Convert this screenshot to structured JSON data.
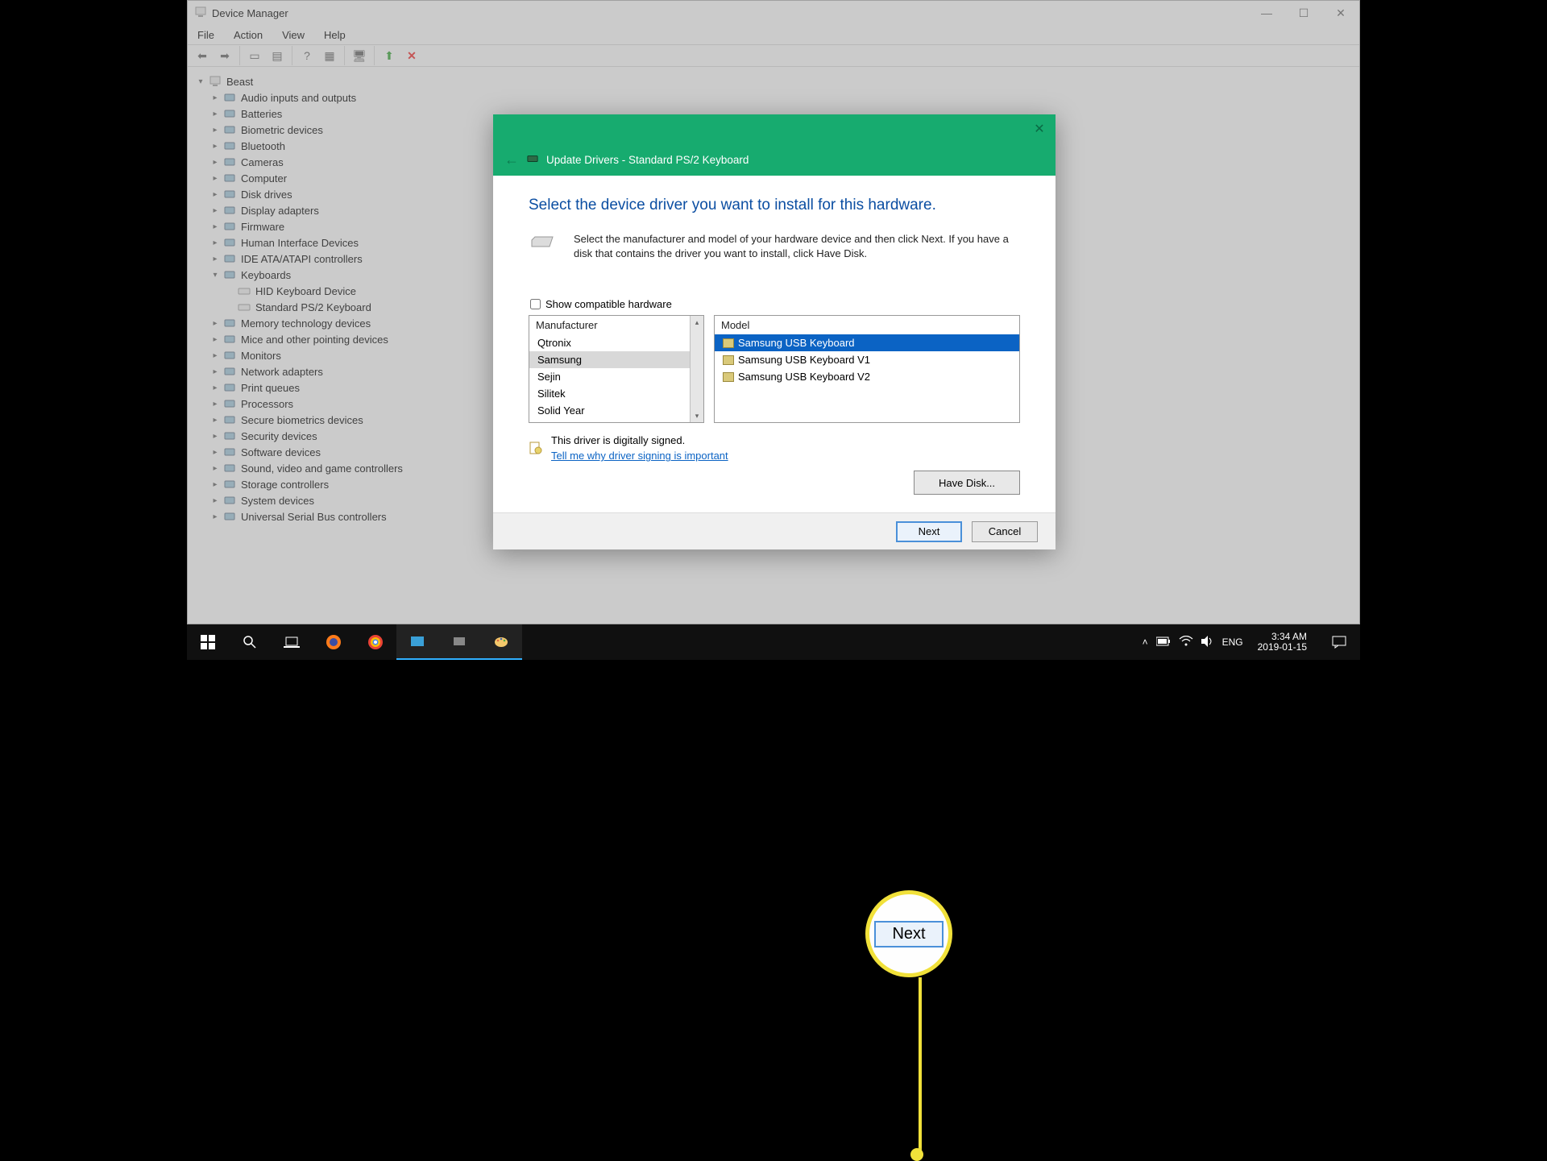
{
  "window": {
    "title": "Device Manager",
    "menus": [
      "File",
      "Action",
      "View",
      "Help"
    ],
    "controls": {
      "minimize": "—",
      "maximize": "☐",
      "close": "✕"
    }
  },
  "tree": {
    "root": "Beast",
    "nodes": [
      {
        "label": "Audio inputs and outputs",
        "expanded": false
      },
      {
        "label": "Batteries",
        "expanded": false
      },
      {
        "label": "Biometric devices",
        "expanded": false
      },
      {
        "label": "Bluetooth",
        "expanded": false
      },
      {
        "label": "Cameras",
        "expanded": false
      },
      {
        "label": "Computer",
        "expanded": false
      },
      {
        "label": "Disk drives",
        "expanded": false
      },
      {
        "label": "Display adapters",
        "expanded": false
      },
      {
        "label": "Firmware",
        "expanded": false
      },
      {
        "label": "Human Interface Devices",
        "expanded": false
      },
      {
        "label": "IDE ATA/ATAPI controllers",
        "expanded": false
      },
      {
        "label": "Keyboards",
        "expanded": true,
        "children": [
          {
            "label": "HID Keyboard Device"
          },
          {
            "label": "Standard PS/2 Keyboard"
          }
        ]
      },
      {
        "label": "Memory technology devices",
        "expanded": false
      },
      {
        "label": "Mice and other pointing devices",
        "expanded": false
      },
      {
        "label": "Monitors",
        "expanded": false
      },
      {
        "label": "Network adapters",
        "expanded": false
      },
      {
        "label": "Print queues",
        "expanded": false
      },
      {
        "label": "Processors",
        "expanded": false
      },
      {
        "label": "Secure biometrics devices",
        "expanded": false
      },
      {
        "label": "Security devices",
        "expanded": false
      },
      {
        "label": "Software devices",
        "expanded": false
      },
      {
        "label": "Sound, video and game controllers",
        "expanded": false
      },
      {
        "label": "Storage controllers",
        "expanded": false
      },
      {
        "label": "System devices",
        "expanded": false
      },
      {
        "label": "Universal Serial Bus controllers",
        "expanded": false
      }
    ]
  },
  "wizard": {
    "title": "Update Drivers - Standard PS/2 Keyboard",
    "heading": "Select the device driver you want to install for this hardware.",
    "instructions": "Select the manufacturer and model of your hardware device and then click Next. If you have a disk that contains the driver you want to install, click Have Disk.",
    "show_compatible_label": "Show compatible hardware",
    "show_compatible_checked": false,
    "manufacturer_header": "Manufacturer",
    "model_header": "Model",
    "manufacturers": [
      "Qtronix",
      "Samsung",
      "Sejin",
      "Silitek",
      "Solid Year"
    ],
    "manufacturer_selected_index": 1,
    "models": [
      "Samsung USB Keyboard",
      "Samsung USB Keyboard V1",
      "Samsung USB Keyboard V2"
    ],
    "model_selected_index": 0,
    "signed_text": "This driver is digitally signed.",
    "signing_link": "Tell me why driver signing is important",
    "have_disk": "Have Disk...",
    "next": "Next",
    "cancel": "Cancel"
  },
  "callout": {
    "label": "Next"
  },
  "taskbar": {
    "lang": "ENG",
    "time": "3:34 AM",
    "date": "2019-01-15"
  }
}
